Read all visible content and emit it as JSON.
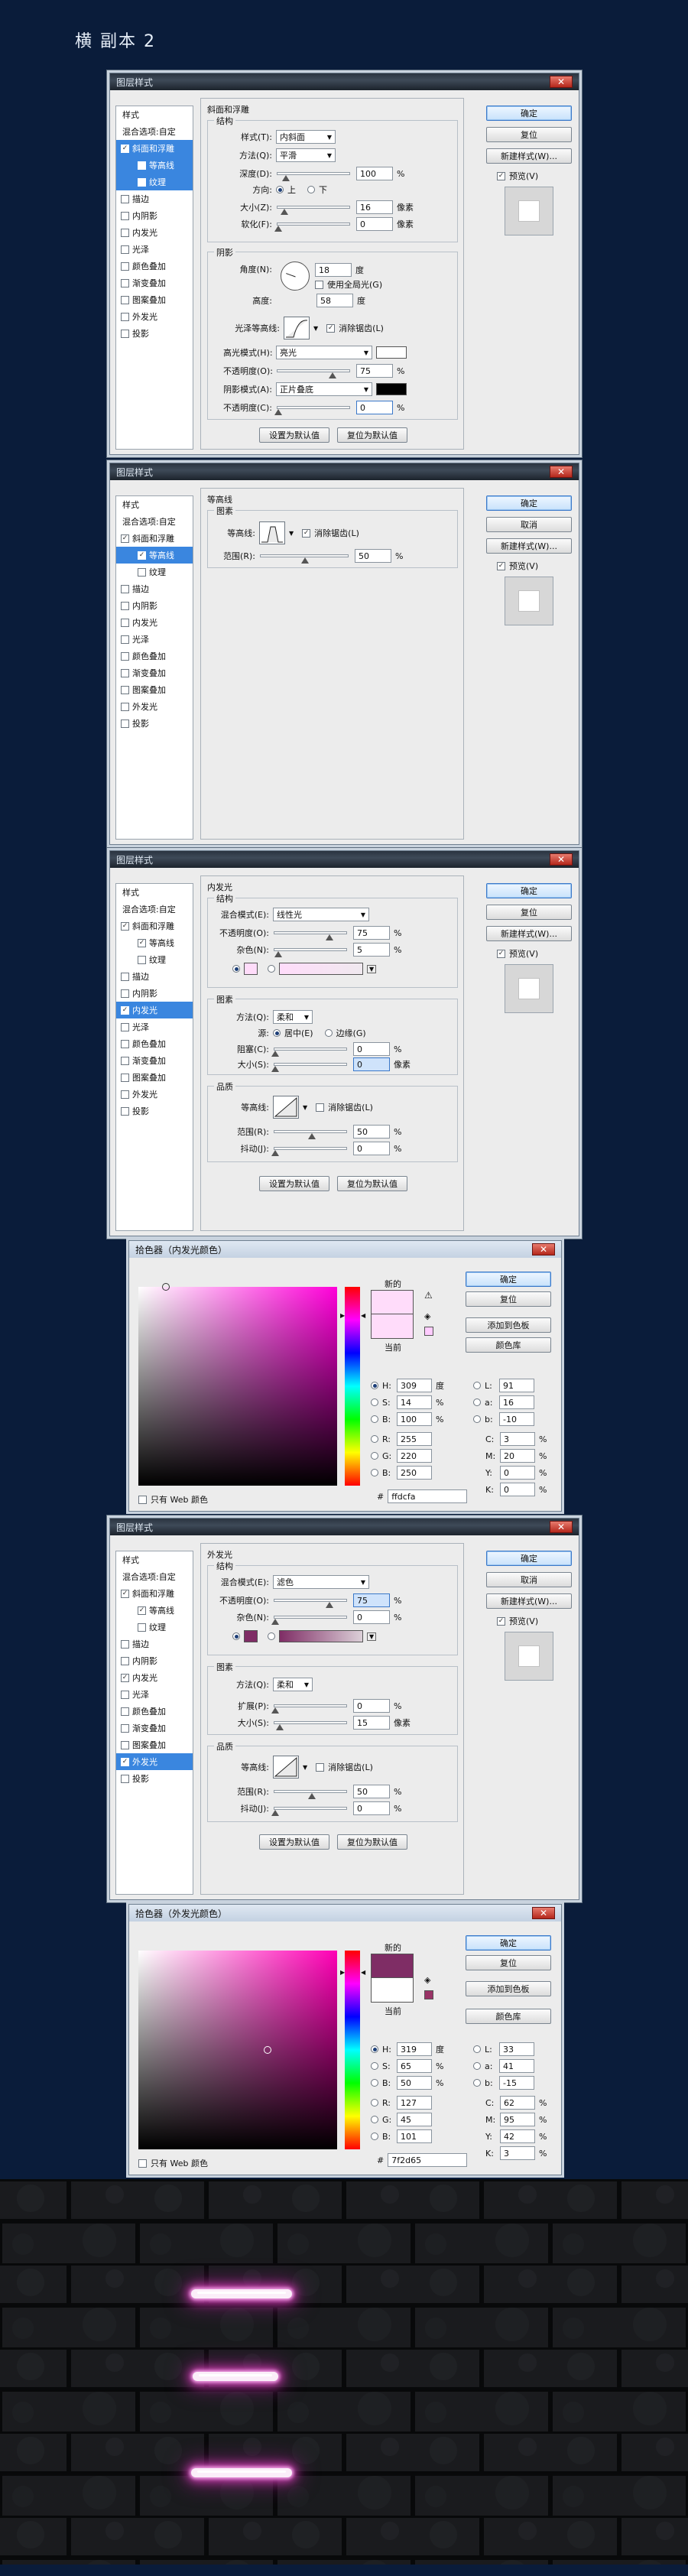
{
  "page_title": "横 副本 2",
  "dialog_title": "图层样式",
  "sidebar": {
    "header": "样式",
    "blend": "混合选项:自定",
    "items": [
      "斜面和浮雕",
      "等高线",
      "纹理",
      "描边",
      "内阴影",
      "内发光",
      "光泽",
      "颜色叠加",
      "渐变叠加",
      "图案叠加",
      "外发光",
      "投影"
    ]
  },
  "buttons": {
    "ok": "确定",
    "reset": "复位",
    "cancel": "取消",
    "new_style": "新建样式(W)...",
    "preview": "预览(V)",
    "set_default": "设置为默认值",
    "reset_default": "复位为默认值"
  },
  "bevel": {
    "title": "斜面和浮雕",
    "structure": "结构",
    "style_label": "样式(T):",
    "style": "内斜面",
    "method_label": "方法(Q):",
    "method": "平滑",
    "depth_label": "深度(D):",
    "depth": "100",
    "pct": "%",
    "dir_label": "方向:",
    "up": "上",
    "down": "下",
    "size_label": "大小(Z):",
    "size": "16",
    "px": "像素",
    "soften_label": "软化(F):",
    "soften": "0",
    "shading": "阴影",
    "angle_label": "角度(N):",
    "angle": "18",
    "deg": "度",
    "global": "使用全局光(G)",
    "altitude_label": "高度:",
    "altitude": "58",
    "gloss_label": "光泽等高线:",
    "antialias": "消除锯齿(L)",
    "hl_label": "高光模式(H):",
    "hl_mode": "亮光",
    "op_label": "不透明度(O):",
    "hl_op": "75",
    "sh_label": "阴影模式(A):",
    "sh_mode": "正片叠底",
    "sh_op_label": "不透明度(C):",
    "sh_op": "0"
  },
  "contour": {
    "title": "等高线",
    "elements": "图素",
    "contour_label": "等高线:",
    "antialias": "消除锯齿(L)",
    "range_label": "范围(R):",
    "range": "50",
    "pct": "%"
  },
  "inner_glow": {
    "title": "内发光",
    "structure": "结构",
    "blend_label": "混合模式(E):",
    "blend": "线性光",
    "op_label": "不透明度(O):",
    "opacity": "75",
    "pct": "%",
    "noise_label": "杂色(N):",
    "noise": "5",
    "elements": "图素",
    "tech_label": "方法(Q):",
    "technique": "柔和",
    "source_label": "源:",
    "center": "居中(E)",
    "edge": "边缘(G)",
    "choke_label": "阻塞(C):",
    "choke": "0",
    "size_label": "大小(S):",
    "size": "0",
    "px": "像素",
    "quality": "品质",
    "contour_label": "等高线:",
    "antialias": "消除锯齿(L)",
    "range_label": "范围(R):",
    "range": "50",
    "jitter_label": "抖动(J):",
    "jitter": "0"
  },
  "outer_glow": {
    "title": "外发光",
    "structure": "结构",
    "blend_label": "混合模式(E):",
    "blend": "滤色",
    "op_label": "不透明度(O):",
    "opacity": "75",
    "pct": "%",
    "noise_label": "杂色(N):",
    "noise": "0",
    "elements": "图素",
    "tech_label": "方法(Q):",
    "technique": "柔和",
    "spread_label": "扩展(P):",
    "spread": "0",
    "size_label": "大小(S):",
    "size": "15",
    "px": "像素",
    "quality": "品质",
    "contour_label": "等高线:",
    "antialias": "消除锯齿(L)",
    "range_label": "范围(R):",
    "range": "50",
    "jitter_label": "抖动(J):",
    "jitter": "0"
  },
  "picker1": {
    "title": "拾色器（内发光颜色）",
    "new": "新的",
    "current": "当前",
    "btn_ok": "确定",
    "btn_reset": "复位",
    "btn_add": "添加到色板",
    "btn_lib": "颜色库",
    "h": "309",
    "s": "14",
    "b": "100",
    "r": "255",
    "g": "220",
    "bb": "250",
    "l": "91",
    "a": "16",
    "lb": "-10",
    "c": "3",
    "m": "20",
    "y": "0",
    "k": "0",
    "hex": "ffdcfa",
    "web": "只有 Web 颜色",
    "new_color": "#ffdcfa",
    "cur_color": "#ffdcfa",
    "hue_color": "#ff00d9"
  },
  "picker2": {
    "title": "拾色器（外发光颜色）",
    "new": "新的",
    "current": "当前",
    "btn_ok": "确定",
    "btn_reset": "复位",
    "btn_add": "添加到色板",
    "btn_lib": "颜色库",
    "h": "319",
    "s": "65",
    "b": "50",
    "r": "127",
    "g": "45",
    "bb": "101",
    "l": "33",
    "a": "41",
    "lb": "-15",
    "c": "62",
    "m": "95",
    "y": "42",
    "k": "3",
    "hex": "7f2d65",
    "web": "只有 Web 颜色",
    "new_color": "#7f2d65",
    "cur_color": "#ffffff",
    "hue_color": "#ff00b5"
  },
  "units": {
    "deg": "度",
    "pct": "%"
  }
}
